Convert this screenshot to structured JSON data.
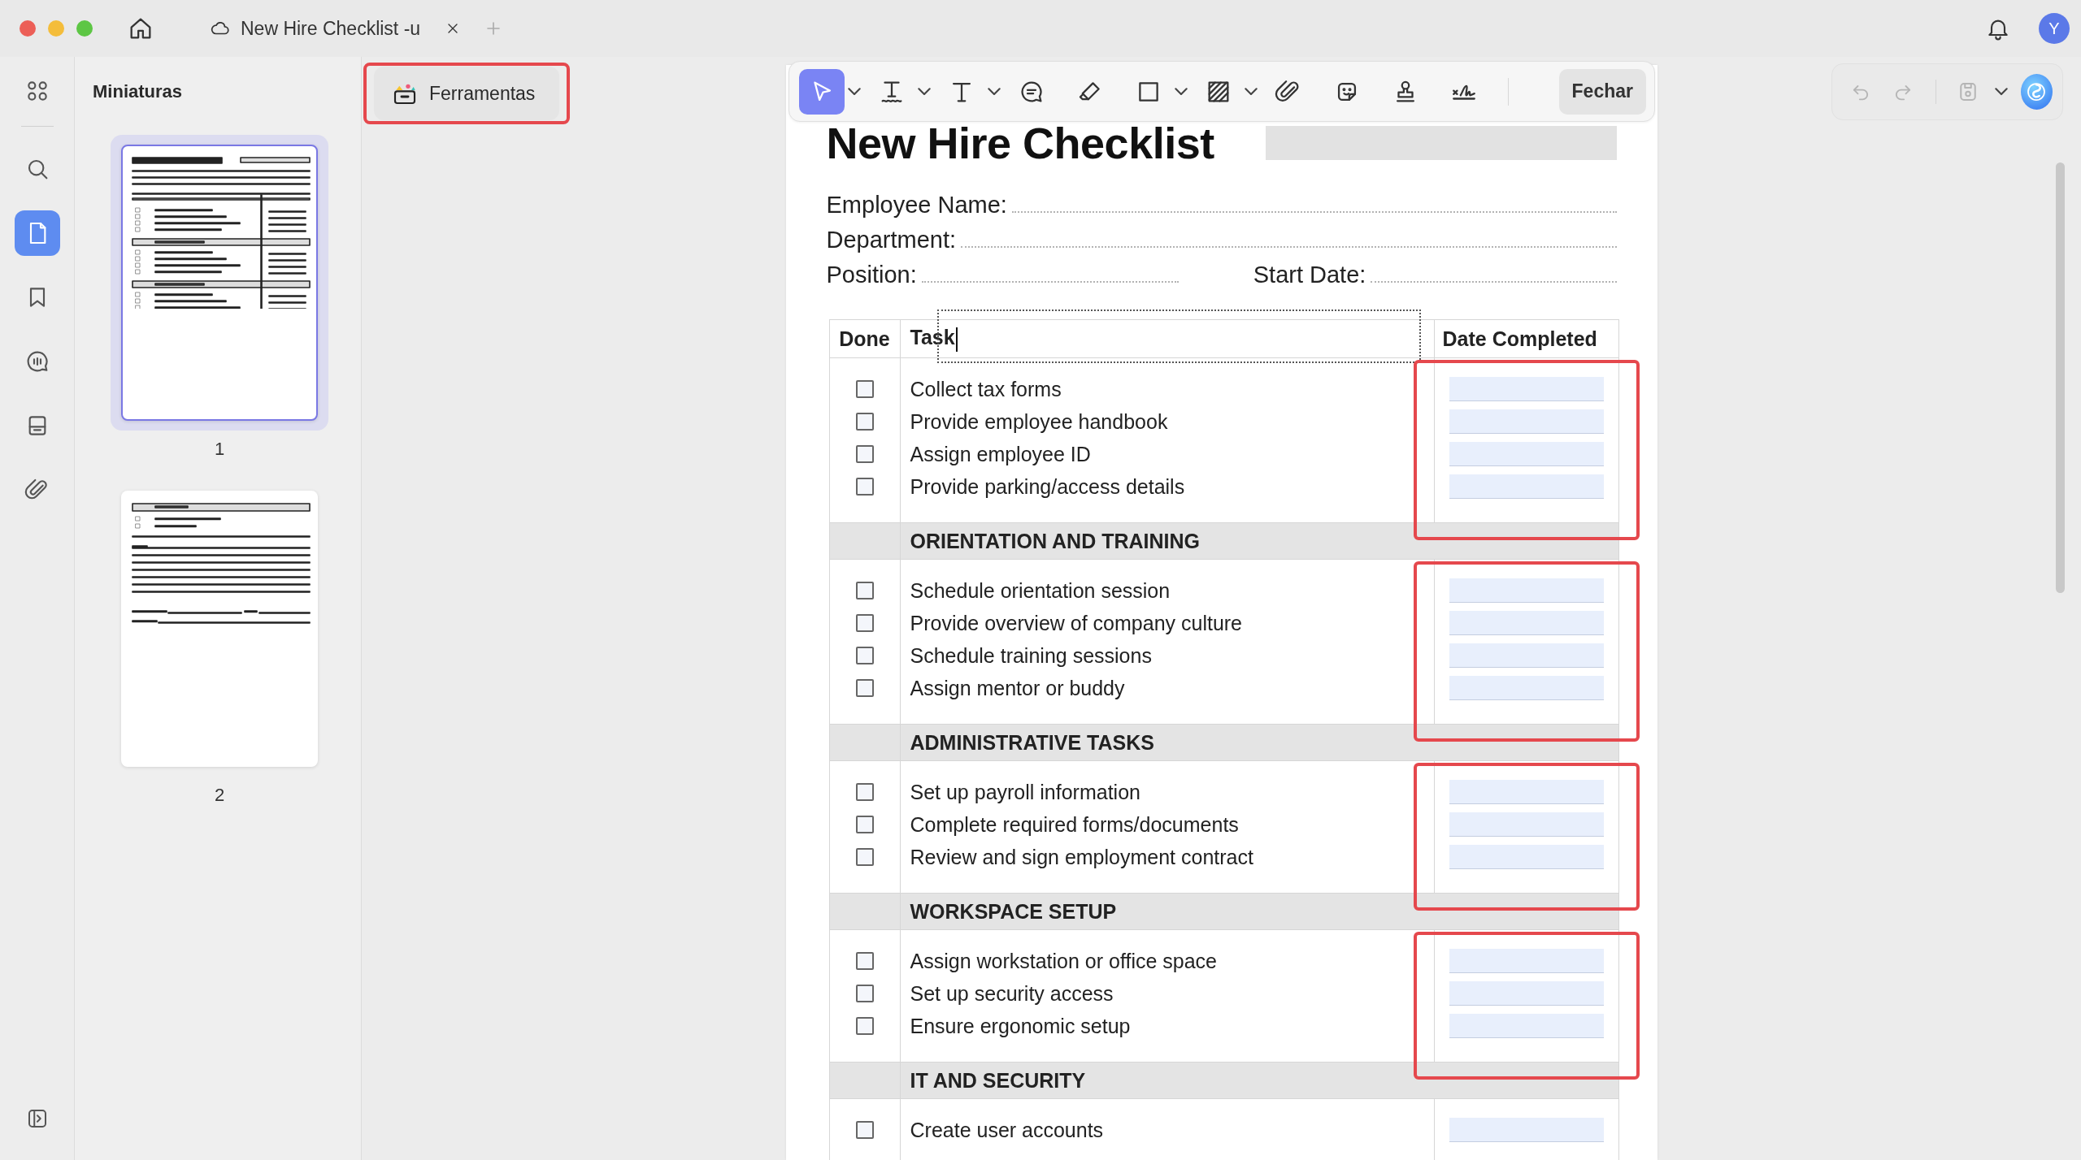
{
  "window": {
    "tab_title": "New Hire Checklist -u",
    "avatar": "Y"
  },
  "rail": [
    {
      "kind": "apps",
      "selected": false
    },
    {
      "kind": "search",
      "selected": false
    },
    {
      "kind": "pages",
      "selected": true
    },
    {
      "kind": "bookmark",
      "selected": false
    },
    {
      "kind": "comments",
      "selected": false
    },
    {
      "kind": "forms",
      "selected": false
    },
    {
      "kind": "attachment",
      "selected": false
    }
  ],
  "thumbnail_panel": {
    "title": "Miniaturas",
    "pages": [
      {
        "label": "1",
        "selected": true,
        "kind": "checklist"
      },
      {
        "label": "2",
        "selected": false,
        "kind": "notes"
      }
    ]
  },
  "tools_button": {
    "label": "Ferramentas",
    "highlighted": true
  },
  "toolbar": {
    "tools": [
      {
        "kind": "select",
        "selected": true,
        "dropdown": true
      },
      {
        "kind": "text-box",
        "selected": false,
        "dropdown": true
      },
      {
        "kind": "text",
        "selected": false,
        "dropdown": true
      },
      {
        "kind": "comment",
        "selected": false,
        "dropdown": false
      },
      {
        "kind": "eraser",
        "selected": false,
        "dropdown": false
      },
      {
        "kind": "shape",
        "selected": false,
        "dropdown": true
      },
      {
        "kind": "area",
        "selected": false,
        "dropdown": true
      },
      {
        "kind": "attachment",
        "selected": false,
        "dropdown": false
      },
      {
        "kind": "sticker",
        "selected": false,
        "dropdown": false
      },
      {
        "kind": "stamp",
        "selected": false,
        "dropdown": false
      },
      {
        "kind": "signature",
        "selected": false,
        "dropdown": false
      }
    ],
    "close_button": "Fechar"
  },
  "history": {
    "undo_disabled": true,
    "redo_disabled": true
  },
  "document": {
    "title": "New Hire Checklist",
    "field_rows": [
      [
        "Employee Name:"
      ],
      [
        "Department:"
      ],
      [
        "Position:",
        "Start Date:"
      ]
    ],
    "columns": [
      "Done",
      "Task",
      "Date Completed"
    ],
    "task_header_editing": true,
    "sections": [
      {
        "highlighted": true,
        "items": [
          {
            "task": "Collect tax forms",
            "checked": false
          },
          {
            "task": "Provide employee handbook",
            "checked": false
          },
          {
            "task": "Assign employee ID",
            "checked": false
          },
          {
            "task": "Provide parking/access details",
            "checked": false
          }
        ]
      },
      {
        "heading": "ORIENTATION AND TRAINING",
        "highlighted": true,
        "items": [
          {
            "task": "Schedule orientation session",
            "checked": false
          },
          {
            "task": "Provide overview of company culture",
            "checked": false
          },
          {
            "task": "Schedule training sessions",
            "checked": false
          },
          {
            "task": "Assign mentor or buddy",
            "checked": false
          }
        ]
      },
      {
        "heading": "ADMINISTRATIVE TASKS",
        "highlighted": true,
        "items": [
          {
            "task": "Set up payroll information",
            "checked": false
          },
          {
            "task": "Complete required forms/documents",
            "checked": false
          },
          {
            "task": "Review and sign employment contract",
            "checked": false
          }
        ]
      },
      {
        "heading": "WORKSPACE SETUP",
        "highlighted": true,
        "items": [
          {
            "task": "Assign workstation or office space",
            "checked": false
          },
          {
            "task": "Set up security access",
            "checked": false
          },
          {
            "task": "Ensure ergonomic setup",
            "checked": false
          }
        ]
      },
      {
        "heading": "IT AND SECURITY",
        "highlighted": false,
        "items": [
          {
            "task": "Create user accounts",
            "checked": false
          }
        ]
      }
    ]
  }
}
